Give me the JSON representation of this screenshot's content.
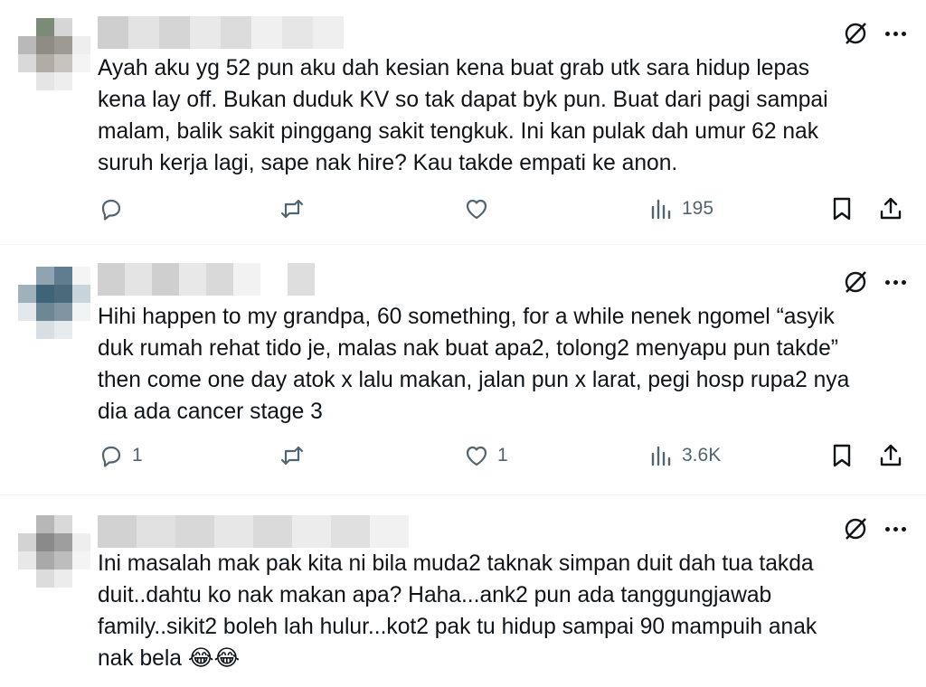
{
  "tweets": [
    {
      "text": "Ayah aku yg 52 pun aku dah kesian kena buat grab utk sara hidup lepas\nkena lay off. Bukan duduk KV so tak dapat byk pun. Buat dari pagi sampai\nmalam, balik sakit pinggang sakit tengkuk. Ini kan pulak dah umur 62 nak\nsuruh kerja lagi, sape nak hire? Kau takde empati ke anon.",
      "replies": "",
      "retweets": "",
      "likes": "",
      "views": "195"
    },
    {
      "text": "Hihi happen to my grandpa, 60 something, for a while nenek ngomel “asyik\nduk rumah rehat tido je, malas nak buat apa2, tolong2 menyapu pun takde”\nthen come one day atok x lalu makan, jalan pun x larat, pegi hosp rupa2 nya\ndia ada cancer stage 3",
      "replies": "1",
      "retweets": "",
      "likes": "1",
      "views": "3.6K"
    },
    {
      "text": "Ini masalah mak pak kita ni bila muda2 taknak simpan duit dah tua takda\nduit..dahtu ko nak makan apa? Haha...ank2 pun ada tanggungjawab\nfamily..sikit2 boleh lah hulur...kot2 pak tu hidup sampai 90 mampuih anak\nnak bela 😂😂",
      "replies": "",
      "retweets": "",
      "likes": "",
      "views": ""
    }
  ],
  "icons": {
    "reply": "reply-icon",
    "retweet": "retweet-icon",
    "like": "heart-icon",
    "views": "views-icon",
    "bookmark": "bookmark-icon",
    "share": "share-icon",
    "grok": "grok-icon",
    "more": "more-icon"
  },
  "colors": {
    "icon_gray": "#536471",
    "text": "#0f1419",
    "divider": "#eff3f4"
  }
}
